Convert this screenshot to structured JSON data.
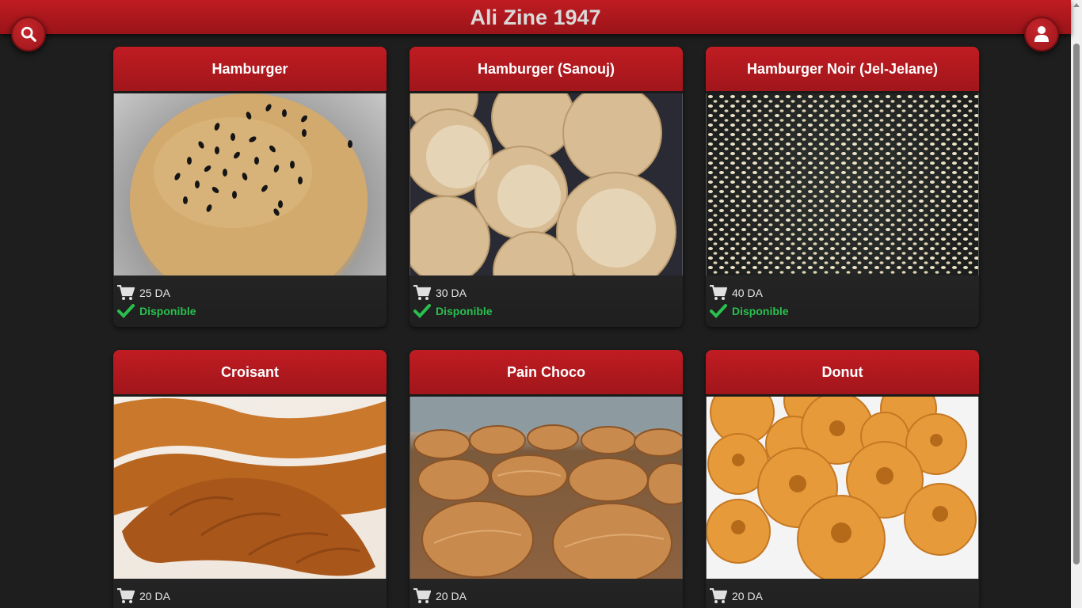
{
  "app": {
    "title": "Ali Zine 1947"
  },
  "header": {
    "search_icon": "search-icon",
    "user_icon": "user-icon"
  },
  "colors": {
    "brand_red": "#b31a20",
    "available_green": "#29c04f",
    "background": "#1e1e1e"
  },
  "products": [
    {
      "name": "Hamburger",
      "price": "25 DA",
      "status": "Disponible"
    },
    {
      "name": "Hamburger (Sanouj)",
      "price": "30 DA",
      "status": "Disponible"
    },
    {
      "name": "Hamburger Noir (Jel-Jelane)",
      "price": "40 DA",
      "status": "Disponible"
    },
    {
      "name": "Croisant",
      "price": "20 DA",
      "status": ""
    },
    {
      "name": "Pain Choco",
      "price": "20 DA",
      "status": ""
    },
    {
      "name": "Donut",
      "price": "20 DA",
      "status": ""
    }
  ]
}
